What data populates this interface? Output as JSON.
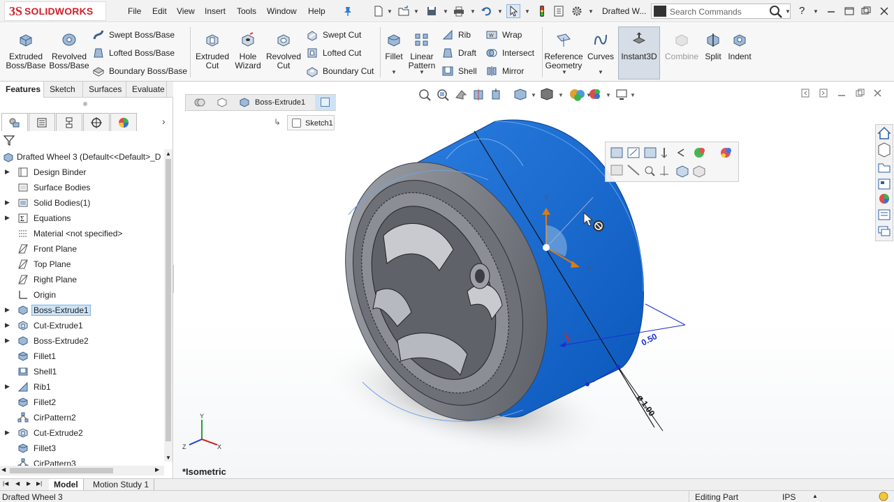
{
  "app": {
    "logo_prefix": "3S",
    "logo_text": "SOLIDWORKS"
  },
  "menu": [
    "File",
    "Edit",
    "View",
    "Insert",
    "Tools",
    "Window",
    "Help"
  ],
  "title": {
    "document": "Drafted W..."
  },
  "search": {
    "placeholder": "Search Commands"
  },
  "ribbon": {
    "extruded_boss": "Extruded Boss/Base",
    "revolved_boss": "Revolved Boss/Base",
    "swept_boss": "Swept Boss/Base",
    "lofted_boss": "Lofted Boss/Base",
    "boundary_boss": "Boundary Boss/Base",
    "extruded_cut": "Extruded Cut",
    "hole_wizard": "Hole Wizard",
    "revolved_cut": "Revolved Cut",
    "swept_cut": "Swept Cut",
    "lofted_cut": "Lofted Cut",
    "boundary_cut": "Boundary Cut",
    "fillet": "Fillet",
    "linear_pattern": "Linear Pattern",
    "rib": "Rib",
    "draft": "Draft",
    "shell": "Shell",
    "wrap": "Wrap",
    "intersect": "Intersect",
    "mirror": "Mirror",
    "reference_geometry": "Reference Geometry",
    "curves": "Curves",
    "instant3d": "Instant3D",
    "combine": "Combine",
    "split": "Split",
    "indent": "Indent"
  },
  "tabs": [
    "Features",
    "Sketch",
    "Surfaces",
    "Evaluate"
  ],
  "tree": {
    "root": "Drafted Wheel 3  (Default<<Default>_D",
    "items": [
      {
        "label": "Design Binder",
        "expandable": true,
        "icon": "binder-icon"
      },
      {
        "label": "Surface Bodies",
        "expandable": false,
        "icon": "surface-bodies-icon"
      },
      {
        "label": "Solid Bodies(1)",
        "expandable": true,
        "icon": "solid-bodies-icon"
      },
      {
        "label": "Equations",
        "expandable": true,
        "icon": "equations-icon"
      },
      {
        "label": "Material <not specified>",
        "expandable": false,
        "icon": "material-icon"
      },
      {
        "label": "Front Plane",
        "expandable": false,
        "icon": "plane-icon"
      },
      {
        "label": "Top Plane",
        "expandable": false,
        "icon": "plane-icon"
      },
      {
        "label": "Right Plane",
        "expandable": false,
        "icon": "plane-icon"
      },
      {
        "label": "Origin",
        "expandable": false,
        "icon": "origin-icon"
      },
      {
        "label": "Boss-Extrude1",
        "expandable": true,
        "icon": "boss-extrude-icon",
        "selected": true
      },
      {
        "label": "Cut-Extrude1",
        "expandable": true,
        "icon": "cut-extrude-icon"
      },
      {
        "label": "Boss-Extrude2",
        "expandable": true,
        "icon": "boss-extrude-icon"
      },
      {
        "label": "Fillet1",
        "expandable": false,
        "icon": "fillet-icon"
      },
      {
        "label": "Shell1",
        "expandable": false,
        "icon": "shell-icon"
      },
      {
        "label": "Rib1",
        "expandable": true,
        "icon": "rib-icon"
      },
      {
        "label": "Fillet2",
        "expandable": false,
        "icon": "fillet-icon"
      },
      {
        "label": "CirPattern2",
        "expandable": false,
        "icon": "circular-pattern-icon"
      },
      {
        "label": "Cut-Extrude2",
        "expandable": true,
        "icon": "cut-extrude-icon"
      },
      {
        "label": "Fillet3",
        "expandable": false,
        "icon": "fillet-icon"
      },
      {
        "label": "CirPattern3",
        "expandable": false,
        "icon": "circular-pattern-icon"
      }
    ]
  },
  "breadcrumb": {
    "feature": "Boss-Extrude1",
    "sketch": "Sketch1"
  },
  "viewport": {
    "view_label": "*Isometric",
    "dimension_depth": "0.50",
    "dimension_diameter": "⌀ 1.00",
    "triad_x": "X",
    "triad_y": "Y",
    "triad_z": "Z",
    "body_color": "#0d63c9"
  },
  "bottom_tabs": [
    "Model",
    "Motion Study 1"
  ],
  "status": {
    "left": "Drafted Wheel 3",
    "mode": "Editing Part",
    "units": "IPS"
  }
}
